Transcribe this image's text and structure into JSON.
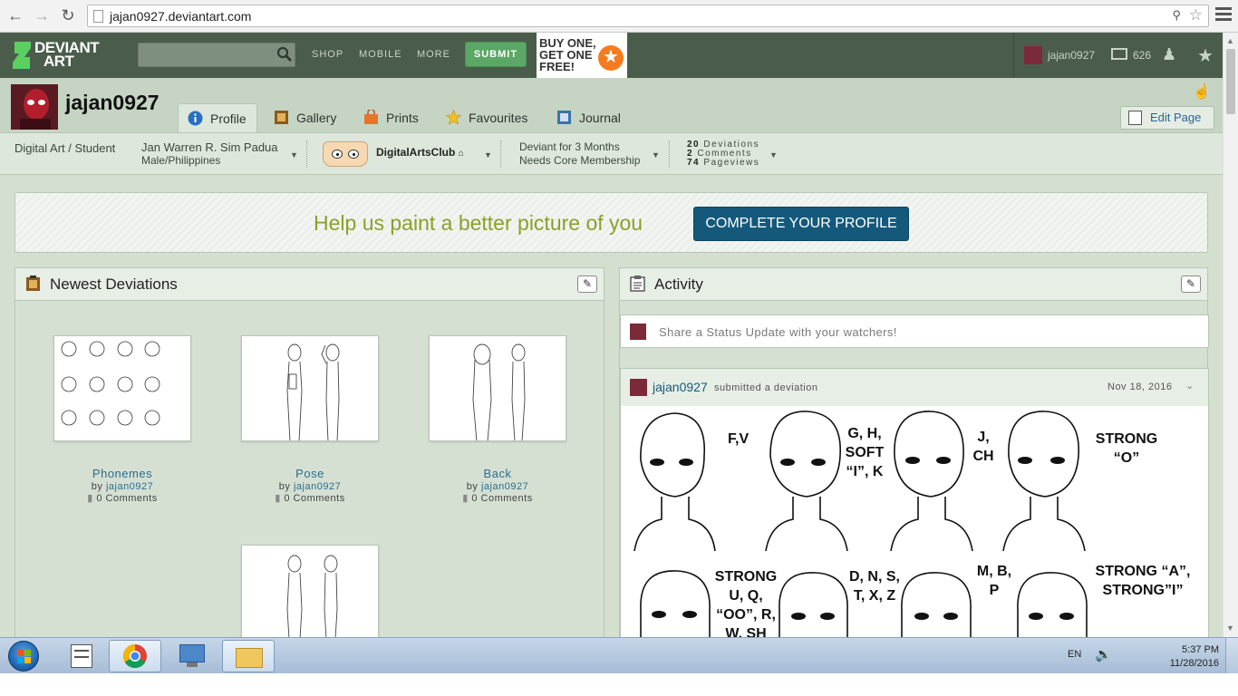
{
  "browser": {
    "url": "jajan0927.deviantart.com"
  },
  "header": {
    "logo_line1": "DEVIANT",
    "logo_line2": "ART",
    "search_placeholder": "",
    "nav": [
      "SHOP",
      "MOBILE",
      "MORE"
    ],
    "submit_label": "SUBMIT",
    "promo_line1": "BUY ONE,",
    "promo_line2": "GET ONE",
    "promo_line3": "FREE!",
    "username": "jajan0927",
    "message_count": "626"
  },
  "profile": {
    "name": "jajan0927",
    "tabs": [
      "Profile",
      "Gallery",
      "Prints",
      "Favourites",
      "Journal"
    ],
    "active_tab": "Profile",
    "edit_page_label": "Edit Page"
  },
  "info": {
    "role": "Digital Art / Student",
    "real_name": "Jan Warren R. Sim Padua",
    "gender_country": "Male/Philippines",
    "club_name": "DigitalArtsClub",
    "membership_duration": "Deviant for 3 Months",
    "membership_status": "Needs Core Membership",
    "stats": {
      "deviations_count": "20",
      "deviations_label": "Deviations",
      "comments_count": "2",
      "comments_label": "Comments",
      "pageviews_count": "74",
      "pageviews_label": "Pageviews"
    }
  },
  "banner": {
    "text": "Help us paint a better picture of you",
    "button_label": "COMPLETE YOUR PROFILE"
  },
  "newest_deviations": {
    "title": "Newest Deviations",
    "items": [
      {
        "title": "Phonemes",
        "by": "by",
        "author": "jajan0927",
        "comments": "0 Comments"
      },
      {
        "title": "Pose",
        "by": "by",
        "author": "jajan0927",
        "comments": "0 Comments"
      },
      {
        "title": "Back",
        "by": "by",
        "author": "jajan0927",
        "comments": "0 Comments"
      }
    ]
  },
  "activity": {
    "title": "Activity",
    "status_placeholder": "Share a Status Update with your watchers!",
    "feed": {
      "user": "jajan0927",
      "action": "submitted a deviation",
      "date": "Nov 18, 2016",
      "image_labels": [
        "F,V",
        "G, H, SOFT “I”, K",
        "J, CH",
        "STRONG “O”",
        "STRONG U, Q, “OO”, R, W, SH",
        "D, N, S, T, X, Z",
        "M, B, P",
        "STRONG “A”, STRONG”I”"
      ]
    }
  },
  "taskbar": {
    "language": "EN",
    "time": "5:37 PM",
    "date": "11/28/2016"
  },
  "colors": {
    "header_bg": "#4a5d4b",
    "page_bg": "#d4dfd0",
    "submit_green": "#5aa766",
    "cta_blue": "#14597a",
    "prompt_olive": "#8aa02a",
    "link_blue": "#2a6d8f"
  }
}
